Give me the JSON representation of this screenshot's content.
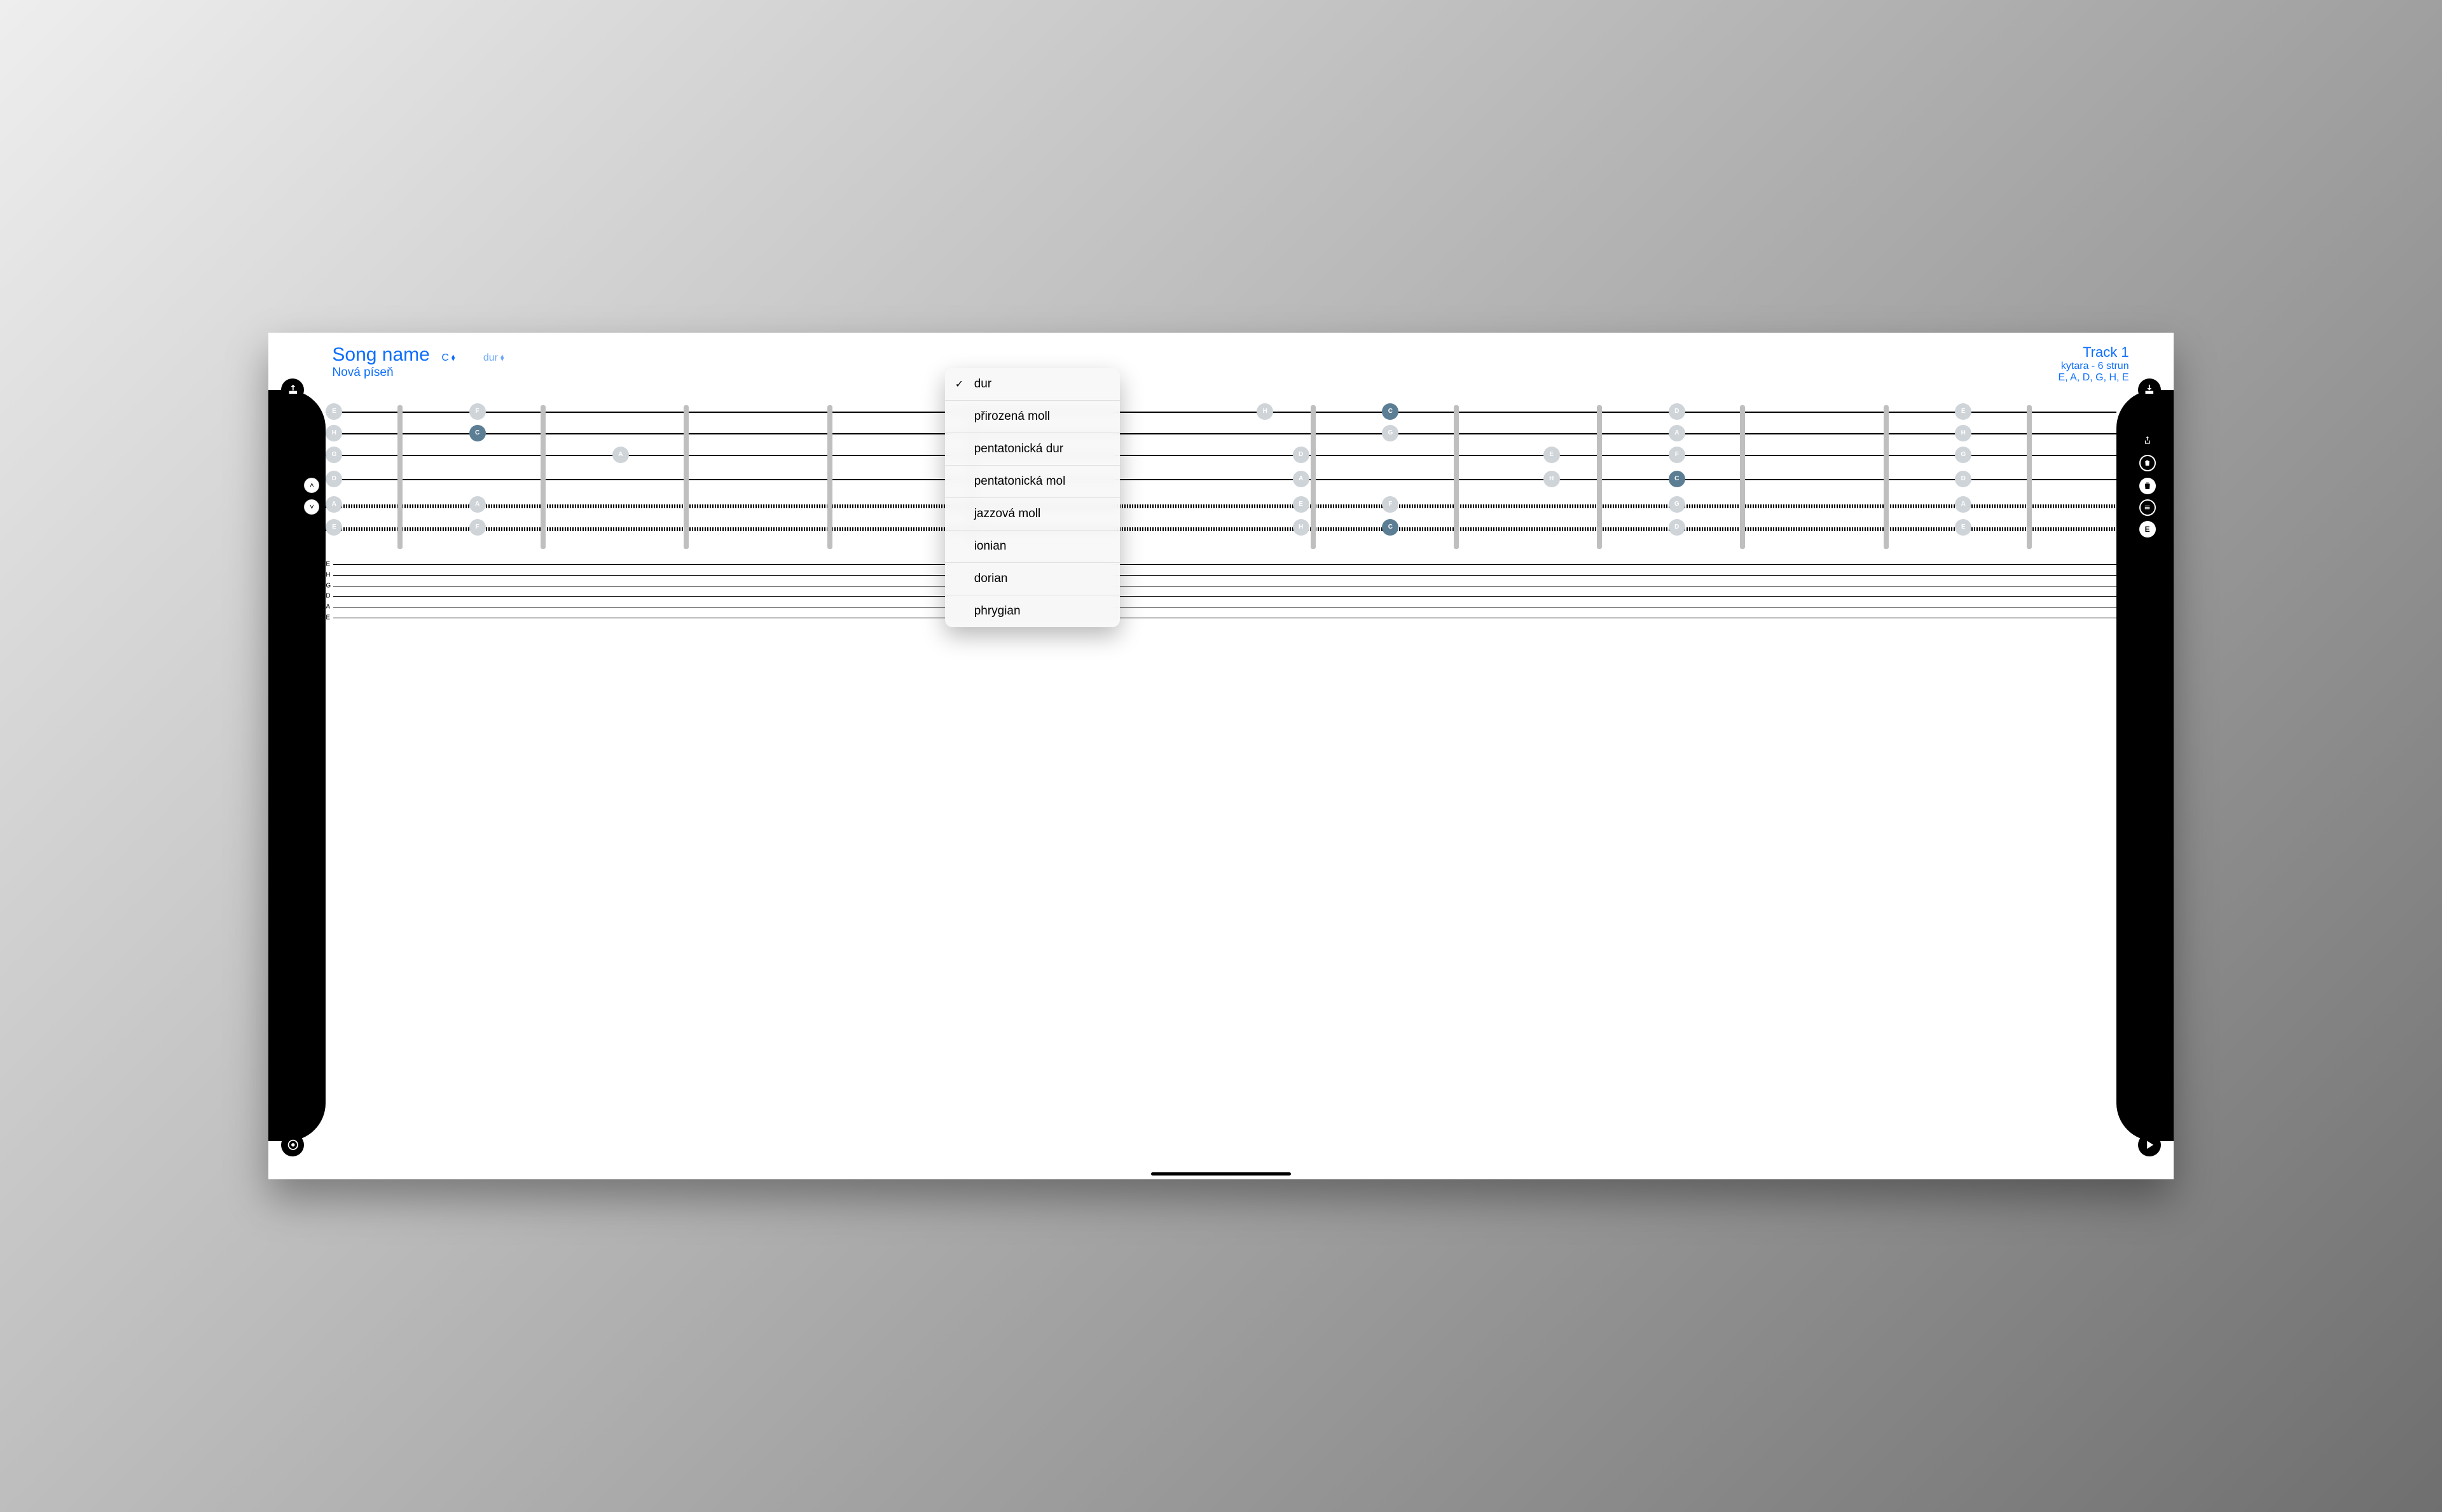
{
  "header": {
    "song_name_label": "Song name",
    "song_subtitle": "Nová píseň",
    "key_selector": "C",
    "scale_selector": "dur",
    "track_name": "Track 1",
    "track_sub": "kytara - 6 strun",
    "track_tuning": "E, A, D, G, H, E"
  },
  "scale_menu": {
    "selected": "dur",
    "items": [
      "dur",
      "přirozená moll",
      "pentatonická dur",
      "pentatonická mol",
      "jazzová moll",
      "ionian",
      "dorian",
      "phrygian"
    ]
  },
  "tab_labels": [
    "E",
    "H",
    "G",
    "D",
    "A",
    "E"
  ],
  "fretboard": {
    "strings": 6,
    "open_notes": [
      "E",
      "H",
      "G",
      "D",
      "A",
      "E"
    ]
  },
  "side_tools": {
    "note_badge": "E"
  },
  "colors": {
    "accent": "#0d6efd",
    "note_default": "#cfd4d9",
    "note_active": "#5c7e94"
  }
}
